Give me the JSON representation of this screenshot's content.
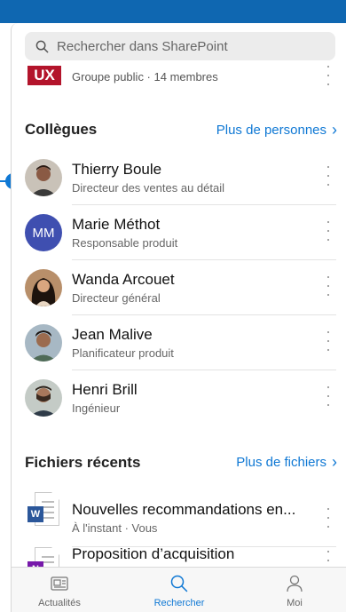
{
  "search": {
    "placeholder": "Rechercher dans SharePoint"
  },
  "group": {
    "badge": "UX",
    "subtitle": "Groupe public · 14 membres"
  },
  "colleagues": {
    "heading": "Collègues",
    "link": "Plus de personnes",
    "people": [
      {
        "name": "Thierry Boule",
        "title": "Directeur des ventes au détail",
        "initials": ""
      },
      {
        "name": "Marie Méthot",
        "title": "Responsable produit",
        "initials": "MM"
      },
      {
        "name": "Wanda Arcouet",
        "title": "Directeur général",
        "initials": ""
      },
      {
        "name": "Jean Malive",
        "title": "Planificateur produit",
        "initials": ""
      },
      {
        "name": "Henri Brill",
        "title": "Ingénieur",
        "initials": ""
      }
    ]
  },
  "files": {
    "heading": "Fichiers récents",
    "link": "Plus de fichiers",
    "items": [
      {
        "name": "Nouvelles recommandations en...",
        "meta": "À l'instant · Vous",
        "badge": "W",
        "color": "#2b579a"
      },
      {
        "name": "Proposition d’acquisition",
        "meta": "",
        "badge": "N",
        "color": "#7719aa"
      }
    ]
  },
  "tabs": {
    "news": "Actualités",
    "search": "Rechercher",
    "me": "Moi"
  },
  "colors": {
    "accent": "#0f78d4",
    "header": "#0f67b1"
  }
}
